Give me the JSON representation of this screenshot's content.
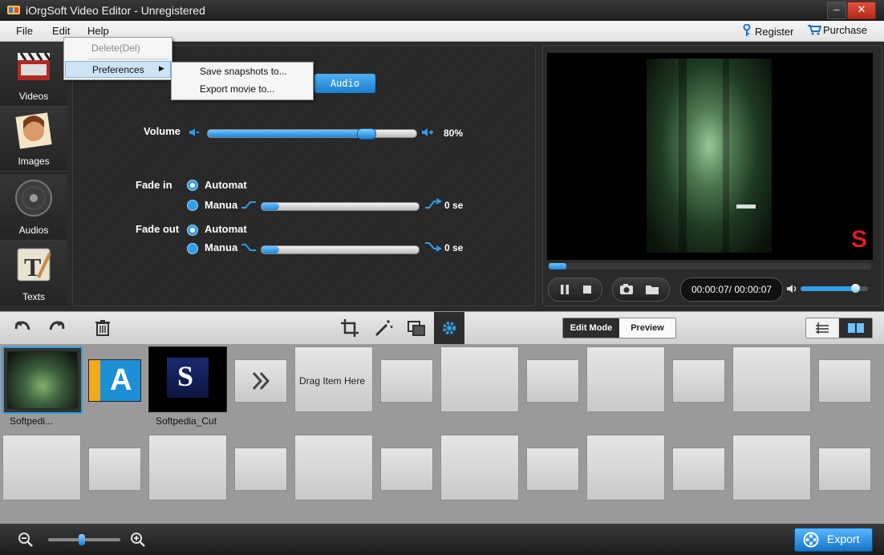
{
  "window": {
    "title": "iOrgSoft Video Editor - Unregistered",
    "min": "–",
    "max": "□",
    "close": "✕"
  },
  "menubar": {
    "file": "File",
    "edit": "Edit",
    "help": "Help",
    "register": "Register",
    "purchase": "Purchase"
  },
  "edit_menu": {
    "delete": "Delete(Del)",
    "preferences": "Preferences"
  },
  "preferences_submenu": {
    "save_snapshots": "Save snapshots to...",
    "export_movie": "Export movie to..."
  },
  "nav": {
    "videos": "Videos",
    "images": "Images",
    "audios": "Audios",
    "texts": "Texts"
  },
  "settings": {
    "tab_audio": "Audio",
    "volume_label": "Volume",
    "volume_value": "80%",
    "volume_level": 0.8,
    "fade_in_label": "Fade in",
    "fade_out_label": "Fade out",
    "automatic": "Automat",
    "manual": "Manua",
    "fade_in_value": "0 se",
    "fade_out_value": "0 se"
  },
  "preview": {
    "timecode": "00:00:07/ 00:00:07",
    "watermark": "S"
  },
  "toolbar": {
    "edit_mode": "Edit Mode",
    "preview": "Preview"
  },
  "storyboard": {
    "item1_label": "Softpedi...",
    "item3_label": "Softpedia_Cut",
    "drag_hint": "Drag Item Here"
  },
  "bottom": {
    "export": "Export"
  },
  "colors": {
    "accent": "#2e9ee8",
    "close": "#d2412c",
    "export": "#1e86dc"
  }
}
